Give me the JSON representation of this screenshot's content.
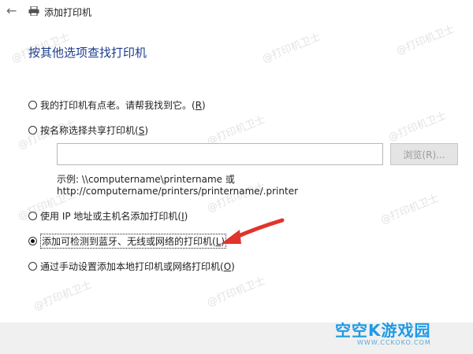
{
  "window": {
    "title": "添加打印机",
    "back_icon": "arrow-left-icon",
    "app_icon": "printer-icon"
  },
  "heading": "按其他选项查找打印机",
  "options": {
    "old": {
      "text": "我的打印机有点老。请帮我找到它。(",
      "hotkey": "R",
      "close": ")",
      "checked": false
    },
    "share": {
      "text": "按名称选择共享打印机(",
      "hotkey": "S",
      "close": ")",
      "checked": false
    },
    "ip": {
      "text": "使用 IP 地址或主机名添加打印机(",
      "hotkey": "I",
      "close": ")",
      "checked": false
    },
    "bluetooth": {
      "text": "添加可检测到蓝牙、无线或网络的打印机(",
      "hotkey": "L",
      "close": ")",
      "checked": true
    },
    "manual": {
      "text": "通过手动设置添加本地打印机或网络打印机(",
      "hotkey": "O",
      "close": ")",
      "checked": false
    }
  },
  "share_input": {
    "value": ""
  },
  "browse_button": {
    "label": "浏览(R)..."
  },
  "example": {
    "line1": "示例: \\\\computername\\printername 或",
    "line2": "http://computername/printers/printername/.printer"
  },
  "watermark": "@打印机卫士",
  "logo": {
    "text": "空空K游戏园",
    "subtext": "WWW.CCKOKO.COM"
  },
  "colors": {
    "heading": "#1c3c8c",
    "arrow": "#e0342c",
    "logo": "#1e9be6"
  }
}
